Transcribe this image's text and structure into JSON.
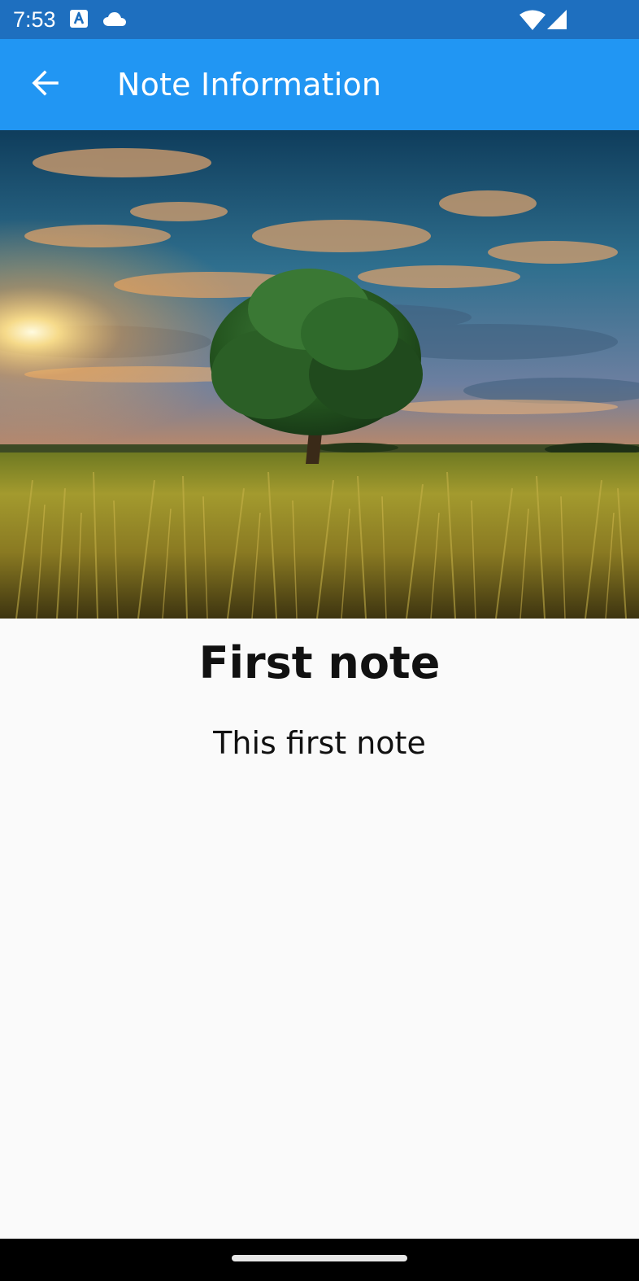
{
  "status_bar": {
    "time": "7:53",
    "icons": [
      "accessibility-a-icon",
      "cloud-icon",
      "wifi-icon",
      "cell-signal-icon"
    ]
  },
  "app_bar": {
    "title": "Note Information",
    "back_icon": "arrow-back-icon"
  },
  "note": {
    "title": "First note",
    "body": "This first note"
  },
  "colors": {
    "status_bar": "#1e6fbf",
    "app_bar": "#2196f3",
    "background": "#fafafa",
    "text": "#111111"
  }
}
